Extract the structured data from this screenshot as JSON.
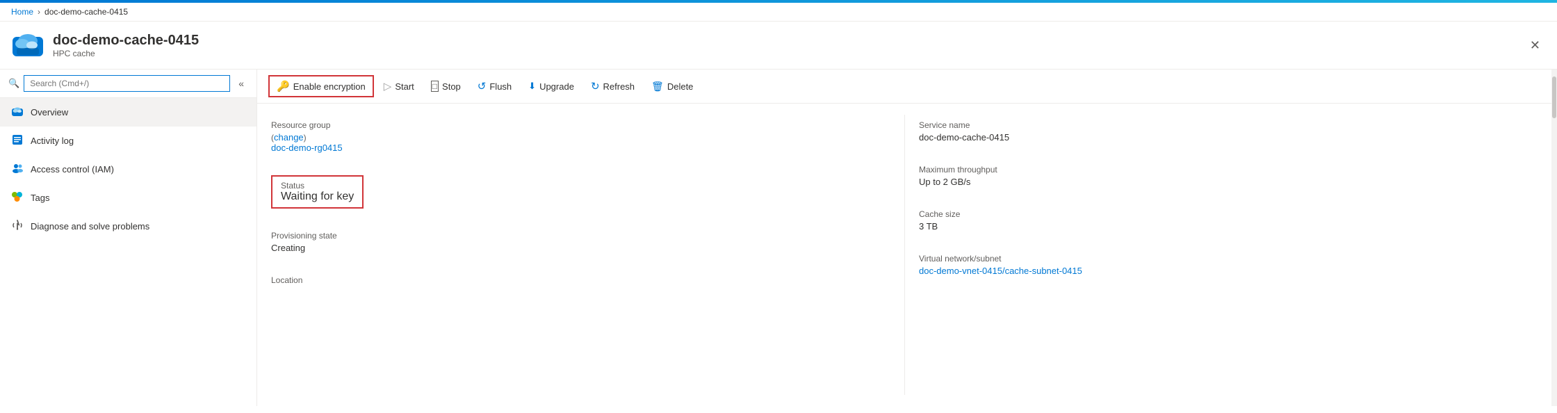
{
  "topbar": {
    "gradient_start": "#0078d4",
    "gradient_end": "#1fb5e2"
  },
  "breadcrumb": {
    "home_label": "Home",
    "separator": "›",
    "current": "doc-demo-cache-0415"
  },
  "header": {
    "title": "doc-demo-cache-0415",
    "subtitle": "HPC cache",
    "close_label": "✕"
  },
  "search": {
    "placeholder": "Search (Cmd+/)",
    "collapse_icon": "«"
  },
  "nav": {
    "items": [
      {
        "id": "overview",
        "label": "Overview",
        "icon": "cloud",
        "active": true
      },
      {
        "id": "activity-log",
        "label": "Activity log",
        "icon": "list"
      },
      {
        "id": "access-control",
        "label": "Access control (IAM)",
        "icon": "people"
      },
      {
        "id": "tags",
        "label": "Tags",
        "icon": "tag"
      },
      {
        "id": "diagnose",
        "label": "Diagnose and solve problems",
        "icon": "wrench"
      }
    ]
  },
  "toolbar": {
    "buttons": [
      {
        "id": "enable-encryption",
        "label": "Enable encryption",
        "icon": "🔑",
        "highlighted": true
      },
      {
        "id": "start",
        "label": "Start",
        "icon": "▷"
      },
      {
        "id": "stop",
        "label": "Stop",
        "icon": "□"
      },
      {
        "id": "flush",
        "label": "Flush",
        "icon": "↺"
      },
      {
        "id": "upgrade",
        "label": "Upgrade",
        "icon": "⬇"
      },
      {
        "id": "refresh",
        "label": "Refresh",
        "icon": "↻"
      },
      {
        "id": "delete",
        "label": "Delete",
        "icon": "🗑"
      }
    ]
  },
  "details": {
    "resource_group_label": "Resource group",
    "resource_group_change": "change",
    "resource_group_value": "doc-demo-rg0415",
    "status_label": "Status",
    "status_value": "Waiting for key",
    "provisioning_label": "Provisioning state",
    "provisioning_value": "Creating",
    "location_label": "Location",
    "location_value": "",
    "service_name_label": "Service name",
    "service_name_value": "doc-demo-cache-0415",
    "max_throughput_label": "Maximum throughput",
    "max_throughput_value": "Up to 2 GB/s",
    "cache_size_label": "Cache size",
    "cache_size_value": "3 TB",
    "virtual_network_label": "Virtual network/subnet",
    "virtual_network_value": "doc-demo-vnet-0415/cache-subnet-0415"
  }
}
